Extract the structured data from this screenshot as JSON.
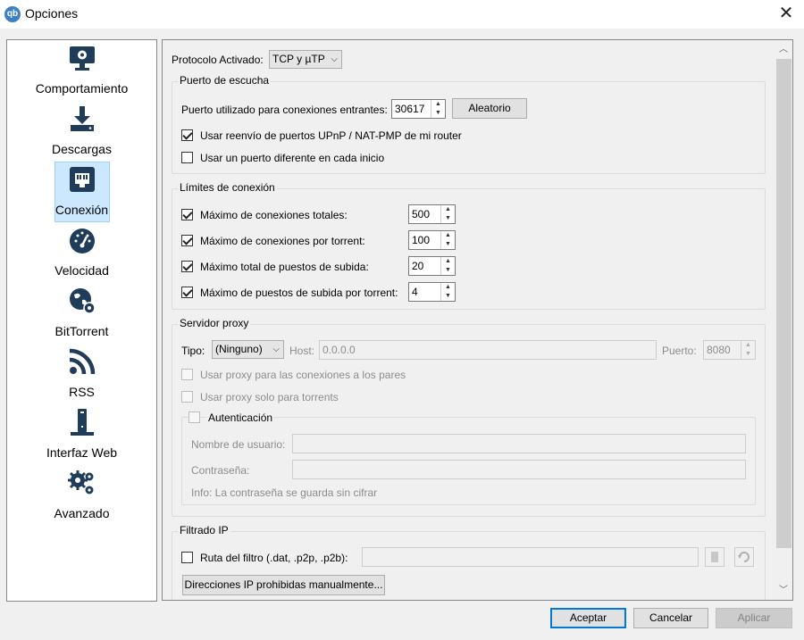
{
  "window": {
    "title": "Opciones",
    "app_icon_text": "qb"
  },
  "sidebar": {
    "items": [
      {
        "label": "Comportamiento",
        "icon": "monitor-settings-icon"
      },
      {
        "label": "Descargas",
        "icon": "download-icon"
      },
      {
        "label": "Conexión",
        "icon": "network-icon",
        "selected": true
      },
      {
        "label": "Velocidad",
        "icon": "speedometer-icon"
      },
      {
        "label": "BitTorrent",
        "icon": "globe-gear-icon"
      },
      {
        "label": "RSS",
        "icon": "rss-icon"
      },
      {
        "label": "Interfaz Web",
        "icon": "server-icon"
      },
      {
        "label": "Avanzado",
        "icon": "gears-icon"
      }
    ]
  },
  "protocol": {
    "label": "Protocolo Activado:",
    "value": "TCP y µTP"
  },
  "listen_port": {
    "title": "Puerto de escucha",
    "port_label": "Puerto utilizado para conexiones entrantes:",
    "port_value": "30617",
    "random_button": "Aleatorio",
    "upnp_label": "Usar reenvío de puertos UPnP / NAT-PMP de mi router",
    "upnp_checked": true,
    "diff_port_label": "Usar un puerto diferente en cada inicio",
    "diff_port_checked": false
  },
  "connection_limits": {
    "title": "Límites de conexión",
    "rows": [
      {
        "label": "Máximo de conexiones totales:",
        "value": "500",
        "checked": true
      },
      {
        "label": "Máximo de conexiones por torrent:",
        "value": "100",
        "checked": true
      },
      {
        "label": "Máximo total de puestos de subida:",
        "value": "20",
        "checked": true
      },
      {
        "label": "Máximo de puestos de subida por torrent:",
        "value": "4",
        "checked": true
      }
    ]
  },
  "proxy": {
    "title": "Servidor proxy",
    "type_label": "Tipo:",
    "type_value": "(Ninguno)",
    "host_label": "Host:",
    "host_value": "0.0.0.0",
    "port_label": "Puerto:",
    "port_value": "8080",
    "peers_label": "Usar proxy para las conexiones a los pares",
    "torrents_label": "Usar proxy solo para torrents",
    "auth_label": "Autenticación",
    "username_label": "Nombre de usuario:",
    "password_label": "Contraseña:",
    "info": "Info: La contraseña se guarda sin cifrar"
  },
  "ip_filter": {
    "title": "Filtrado IP",
    "path_label": "Ruta del filtro (.dat, .p2p, .p2b):",
    "banned_button": "Direcciones IP prohibidas manualmente..."
  },
  "footer": {
    "accept": "Aceptar",
    "cancel": "Cancelar",
    "apply": "Aplicar"
  }
}
